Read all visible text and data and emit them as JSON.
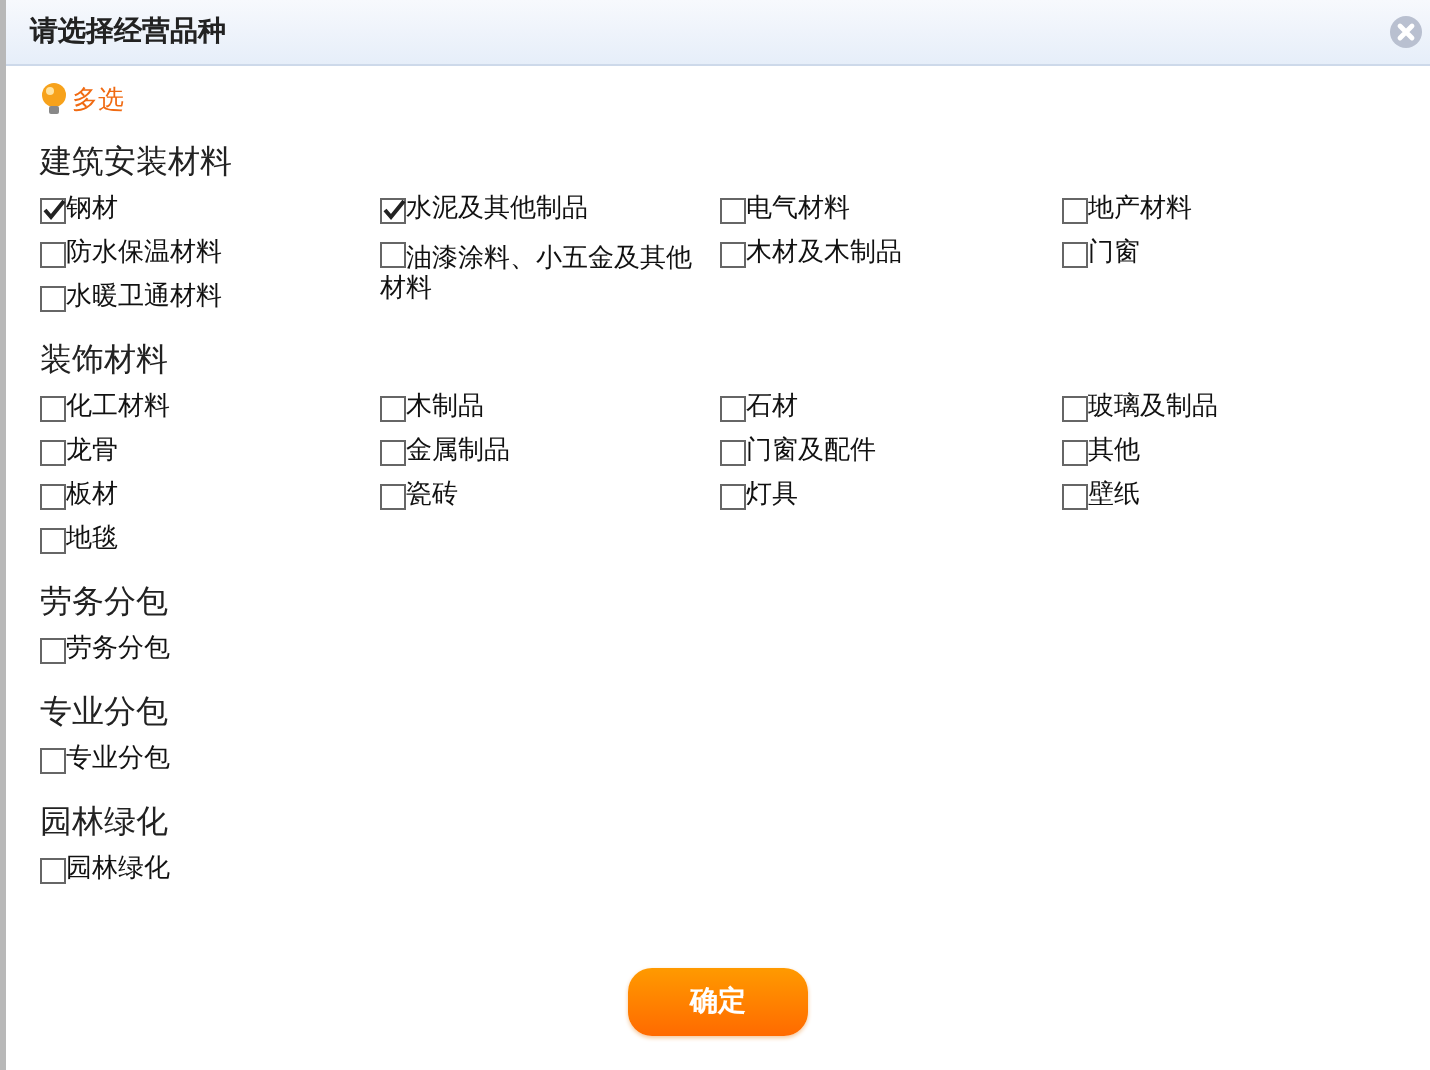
{
  "window": {
    "title": "请选择经营品种"
  },
  "hint": "多选",
  "groups": [
    {
      "title": "建筑安装材料",
      "items": [
        {
          "label": "钢材",
          "checked": true
        },
        {
          "label": "水泥及其他制品",
          "checked": true
        },
        {
          "label": "电气材料",
          "checked": false
        },
        {
          "label": "地产材料",
          "checked": false
        },
        {
          "label": "防水保温材料",
          "checked": false
        },
        {
          "label": "油漆涂料、小五金及其他材料",
          "checked": false
        },
        {
          "label": "木材及木制品",
          "checked": false
        },
        {
          "label": "门窗",
          "checked": false
        },
        {
          "label": "水暖卫通材料",
          "checked": false
        }
      ]
    },
    {
      "title": "装饰材料",
      "items": [
        {
          "label": "化工材料",
          "checked": false
        },
        {
          "label": "木制品",
          "checked": false
        },
        {
          "label": "石材",
          "checked": false
        },
        {
          "label": "玻璃及制品",
          "checked": false
        },
        {
          "label": "龙骨",
          "checked": false
        },
        {
          "label": "金属制品",
          "checked": false
        },
        {
          "label": "门窗及配件",
          "checked": false
        },
        {
          "label": "其他",
          "checked": false
        },
        {
          "label": "板材",
          "checked": false
        },
        {
          "label": "瓷砖",
          "checked": false
        },
        {
          "label": "灯具",
          "checked": false
        },
        {
          "label": "壁纸",
          "checked": false
        },
        {
          "label": "地毯",
          "checked": false
        }
      ]
    },
    {
      "title": "劳务分包",
      "items": [
        {
          "label": "劳务分包",
          "checked": false
        }
      ]
    },
    {
      "title": "专业分包",
      "items": [
        {
          "label": "专业分包",
          "checked": false
        }
      ]
    },
    {
      "title": "园林绿化",
      "items": [
        {
          "label": "园林绿化",
          "checked": false
        }
      ]
    }
  ],
  "buttons": [
    "确定"
  ]
}
